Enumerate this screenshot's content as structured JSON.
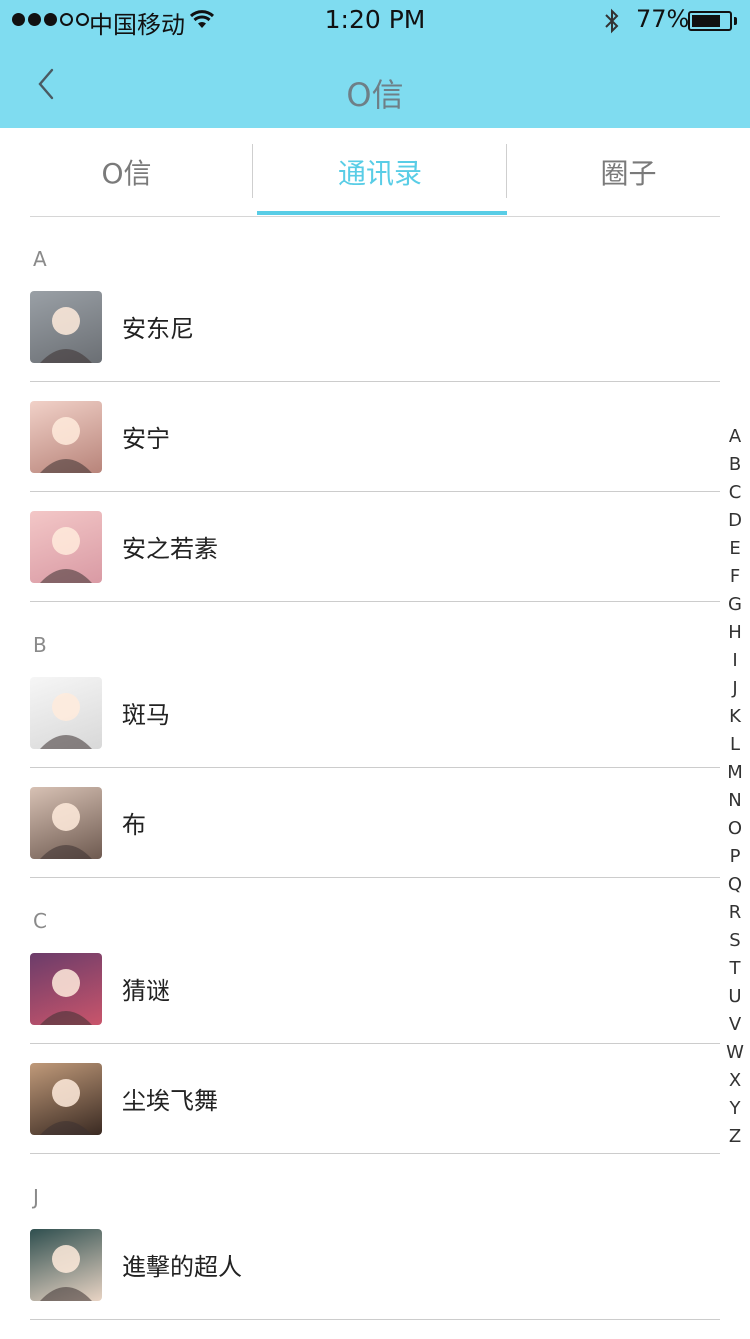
{
  "status_bar": {
    "carrier": "中国移动",
    "time": "1:20 PM",
    "battery_percent": "77%",
    "battery_level": 0.77,
    "signal_strength": 3
  },
  "nav": {
    "title": "O信",
    "back_icon": "chevron-left-icon"
  },
  "tabs": [
    {
      "label": "O信",
      "active": false
    },
    {
      "label": "通讯录",
      "active": true
    },
    {
      "label": "圈子",
      "active": false
    }
  ],
  "colors": {
    "header_bg": "#7fdcf0",
    "accent": "#59cde6"
  },
  "sections": [
    {
      "letter": "A",
      "contacts": [
        {
          "name": "安东尼",
          "avatar": "avatar-photo"
        },
        {
          "name": "安宁",
          "avatar": "avatar-photo"
        },
        {
          "name": "安之若素",
          "avatar": "avatar-photo"
        }
      ]
    },
    {
      "letter": "B",
      "contacts": [
        {
          "name": "斑马",
          "avatar": "avatar-photo"
        },
        {
          "name": "布",
          "avatar": "avatar-photo"
        }
      ]
    },
    {
      "letter": "C",
      "contacts": [
        {
          "name": "猜谜",
          "avatar": "avatar-photo"
        },
        {
          "name": "尘埃飞舞",
          "avatar": "avatar-photo"
        }
      ]
    },
    {
      "letter": "J",
      "contacts": [
        {
          "name": "進擊的超人",
          "avatar": "avatar-photo"
        }
      ]
    }
  ],
  "index_letters": [
    "A",
    "B",
    "C",
    "D",
    "E",
    "F",
    "G",
    "H",
    "I",
    "J",
    "K",
    "L",
    "M",
    "N",
    "O",
    "P",
    "Q",
    "R",
    "S",
    "T",
    "U",
    "V",
    "W",
    "X",
    "Y",
    "Z"
  ]
}
